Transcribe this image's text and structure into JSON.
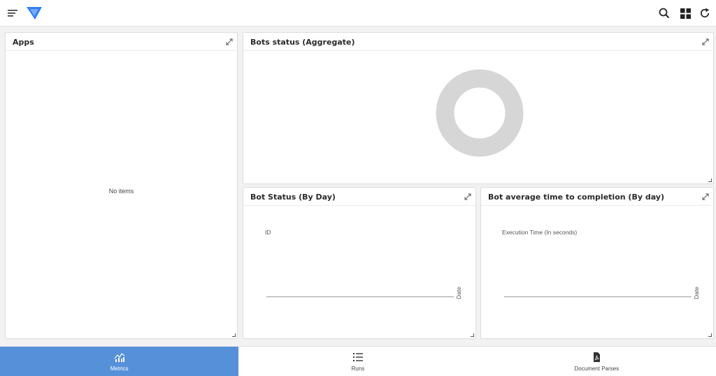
{
  "topbar": {
    "menu_icon": "hamburger-menu-icon",
    "logo_icon": "app-logo-icon",
    "search_icon": "search-icon",
    "layout_icon": "grid-layout-icon",
    "refresh_icon": "refresh-icon",
    "accent_color": "#2d7ff9"
  },
  "panels": {
    "apps": {
      "title": "Apps",
      "empty_text": "No items"
    },
    "aggregate": {
      "title": "Bots status (Aggregate)",
      "donut_color": "#d6d6d6"
    },
    "by_day": {
      "title": "Bot Status (By Day)",
      "y_label": "ID",
      "x_label": "Date"
    },
    "avg_time": {
      "title": "Bot average time to completion (By day)",
      "y_label": "Execution Time (In seconds)",
      "x_label": "Date"
    }
  },
  "bottom_nav": {
    "active_color": "#5590d9",
    "tabs": [
      {
        "label": "Metrics",
        "icon": "metrics-chart-icon",
        "active": true
      },
      {
        "label": "Runs",
        "icon": "list-icon",
        "active": false
      },
      {
        "label": "Document Parses",
        "icon": "pdf-document-icon",
        "active": false
      }
    ]
  }
}
